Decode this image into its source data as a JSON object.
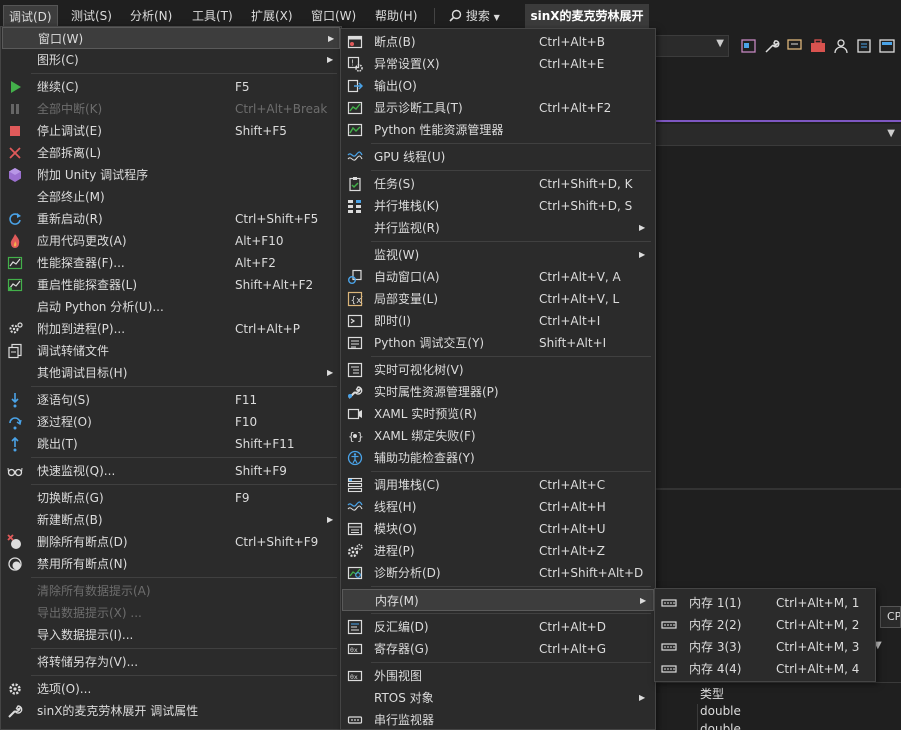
{
  "menubar": {
    "items": [
      "调试(D)",
      "测试(S)",
      "分析(N)",
      "工具(T)",
      "扩展(X)",
      "窗口(W)",
      "帮助(H)"
    ],
    "search": "搜索",
    "title": "sinX的麦克劳林展开"
  },
  "debug_menu": [
    {
      "label": "窗口(W)",
      "shortcut": "",
      "submenu": true,
      "icon": "none",
      "highlighted": true
    },
    {
      "label": "图形(C)",
      "shortcut": "",
      "submenu": true,
      "icon": "none"
    },
    {
      "label": "继续(C)",
      "shortcut": "F5",
      "icon": "play-icon"
    },
    {
      "label": "全部中断(K)",
      "shortcut": "Ctrl+Alt+Break",
      "icon": "pause-icon",
      "disabled": true
    },
    {
      "label": "停止调试(E)",
      "shortcut": "Shift+F5",
      "icon": "stop-icon"
    },
    {
      "label": "全部拆离(L)",
      "shortcut": "",
      "icon": "detach-icon"
    },
    {
      "label": "附加 Unity 调试程序",
      "shortcut": "",
      "icon": "unity-cube-icon"
    },
    {
      "label": "全部终止(M)",
      "shortcut": "",
      "icon": "none"
    },
    {
      "label": "重新启动(R)",
      "shortcut": "Ctrl+Shift+F5",
      "icon": "restart-icon"
    },
    {
      "label": "应用代码更改(A)",
      "shortcut": "Alt+F10",
      "icon": "hot-reload-flame-icon"
    },
    {
      "label": "性能探查器(F)...",
      "shortcut": "Alt+F2",
      "icon": "profiler-icon"
    },
    {
      "label": "重启性能探查器(L)",
      "shortcut": "Shift+Alt+F2",
      "icon": "profiler-restart-icon"
    },
    {
      "label": "启动 Python 分析(U)...",
      "shortcut": "",
      "icon": "none"
    },
    {
      "label": "附加到进程(P)...",
      "shortcut": "Ctrl+Alt+P",
      "icon": "attach-process-gear-icon"
    },
    {
      "label": "调试转储文件",
      "shortcut": "",
      "icon": "dump-file-icon"
    },
    {
      "label": "其他调试目标(H)",
      "shortcut": "",
      "submenu": true,
      "icon": "none"
    },
    {
      "label": "逐语句(S)",
      "shortcut": "F11",
      "icon": "step-into-icon"
    },
    {
      "label": "逐过程(O)",
      "shortcut": "F10",
      "icon": "step-over-icon"
    },
    {
      "label": "跳出(T)",
      "shortcut": "Shift+F11",
      "icon": "step-out-icon"
    },
    {
      "label": "快速监视(Q)...",
      "shortcut": "Shift+F9",
      "icon": "glasses-icon"
    },
    {
      "label": "切换断点(G)",
      "shortcut": "F9",
      "icon": "none"
    },
    {
      "label": "新建断点(B)",
      "shortcut": "",
      "submenu": true,
      "icon": "none"
    },
    {
      "label": "删除所有断点(D)",
      "shortcut": "Ctrl+Shift+F9",
      "icon": "delete-breakpoints-icon"
    },
    {
      "label": "禁用所有断点(N)",
      "shortcut": "",
      "icon": "disable-breakpoints-icon"
    },
    {
      "label": "清除所有数据提示(A)",
      "shortcut": "",
      "icon": "none",
      "disabled": true
    },
    {
      "label": "导出数据提示(X) ...",
      "shortcut": "",
      "icon": "none",
      "disabled": true
    },
    {
      "label": "导入数据提示(I)...",
      "shortcut": "",
      "icon": "none"
    },
    {
      "label": "将转储另存为(V)...",
      "shortcut": "",
      "icon": "none"
    },
    {
      "label": "选项(O)...",
      "shortcut": "",
      "icon": "options-gear-icon"
    },
    {
      "label": "sinX的麦克劳林展开 调试属性",
      "shortcut": "",
      "icon": "wrench-icon"
    }
  ],
  "windows_menu": [
    {
      "label": "断点(B)",
      "shortcut": "Ctrl+Alt+B",
      "icon": "breakpoints-window-icon"
    },
    {
      "label": "异常设置(X)",
      "shortcut": "Ctrl+Alt+E",
      "icon": "exception-settings-icon"
    },
    {
      "label": "输出(O)",
      "shortcut": "",
      "icon": "output-icon"
    },
    {
      "label": "显示诊断工具(T)",
      "shortcut": "Ctrl+Alt+F2",
      "icon": "diagnostic-tools-icon"
    },
    {
      "label": "Python 性能资源管理器",
      "shortcut": "",
      "icon": "python-perf-icon"
    },
    {
      "label": "GPU 线程(U)",
      "shortcut": "",
      "icon": "gpu-threads-icon"
    },
    {
      "label": "任务(S)",
      "shortcut": "Ctrl+Shift+D, K",
      "icon": "tasks-clipboard-icon"
    },
    {
      "label": "并行堆栈(K)",
      "shortcut": "Ctrl+Shift+D, S",
      "icon": "parallel-stacks-icon"
    },
    {
      "label": "并行监视(R)",
      "shortcut": "",
      "submenu": true,
      "icon": "none"
    },
    {
      "label": "监视(W)",
      "shortcut": "",
      "submenu": true,
      "icon": "none"
    },
    {
      "label": "自动窗口(A)",
      "shortcut": "Ctrl+Alt+V, A",
      "icon": "autos-icon"
    },
    {
      "label": "局部变量(L)",
      "shortcut": "Ctrl+Alt+V, L",
      "icon": "locals-icon"
    },
    {
      "label": "即时(I)",
      "shortcut": "Ctrl+Alt+I",
      "icon": "immediate-icon"
    },
    {
      "label": "Python 调试交互(Y)",
      "shortcut": "Shift+Alt+I",
      "icon": "python-interactive-icon"
    },
    {
      "label": "实时可视化树(V)",
      "shortcut": "",
      "icon": "live-visual-tree-icon"
    },
    {
      "label": "实时属性资源管理器(P)",
      "shortcut": "",
      "icon": "live-property-icon"
    },
    {
      "label": "XAML 实时预览(R)",
      "shortcut": "",
      "icon": "xaml-preview-icon"
    },
    {
      "label": "XAML 绑定失败(F)",
      "shortcut": "",
      "icon": "xaml-binding-icon"
    },
    {
      "label": "辅助功能检查器(Y)",
      "shortcut": "",
      "icon": "accessibility-icon"
    },
    {
      "label": "调用堆栈(C)",
      "shortcut": "Ctrl+Alt+C",
      "icon": "call-stack-icon"
    },
    {
      "label": "线程(H)",
      "shortcut": "Ctrl+Alt+H",
      "icon": "threads-icon"
    },
    {
      "label": "模块(O)",
      "shortcut": "Ctrl+Alt+U",
      "icon": "modules-icon"
    },
    {
      "label": "进程(P)",
      "shortcut": "Ctrl+Alt+Z",
      "icon": "processes-gear-icon"
    },
    {
      "label": "诊断分析(D)",
      "shortcut": "Ctrl+Shift+Alt+D",
      "icon": "diagnostic-analysis-icon"
    },
    {
      "label": "内存(M)",
      "shortcut": "",
      "submenu": true,
      "icon": "none",
      "highlighted": true
    },
    {
      "label": "反汇编(D)",
      "shortcut": "Ctrl+Alt+D",
      "icon": "disassembly-icon"
    },
    {
      "label": "寄存器(G)",
      "shortcut": "Ctrl+Alt+G",
      "icon": "registers-icon"
    },
    {
      "label": "外围视图",
      "shortcut": "",
      "icon": "peripheral-icon"
    },
    {
      "label": "RTOS 对象",
      "shortcut": "",
      "submenu": true,
      "icon": "none"
    },
    {
      "label": "串行监视器",
      "shortcut": "",
      "icon": "serial-monitor-icon"
    }
  ],
  "memory_menu": [
    {
      "label": "内存 1(1)",
      "shortcut": "Ctrl+Alt+M, 1",
      "icon": "memory-chip-icon"
    },
    {
      "label": "内存 2(2)",
      "shortcut": "Ctrl+Alt+M, 2",
      "icon": "memory-chip-icon"
    },
    {
      "label": "内存 3(3)",
      "shortcut": "Ctrl+Alt+M, 3",
      "icon": "memory-chip-icon"
    },
    {
      "label": "内存 4(4)",
      "shortcut": "Ctrl+Alt+M, 4",
      "icon": "memory-chip-icon"
    }
  ],
  "background": {
    "cp_label": "CP",
    "type_header": "类型",
    "type_rows": [
      "double",
      "double"
    ]
  },
  "colors": {
    "menu_bg": "#2b2b2b",
    "highlight": "#3d3d3d",
    "accent_purple": "#7e57c2",
    "play_green": "#43b04a",
    "stop_red": "#e05a5a",
    "blue_icon": "#4aa3e8"
  }
}
